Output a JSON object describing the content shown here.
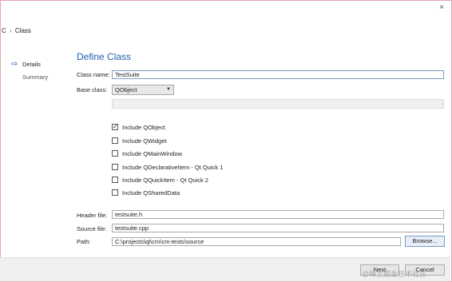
{
  "dialog": {
    "close_glyph": "×"
  },
  "breadcrumb": {
    "parent": "C",
    "separator": "›",
    "current": "Class"
  },
  "sidebar": {
    "items": [
      {
        "label": "Details",
        "active": true
      },
      {
        "label": "Summary",
        "active": false
      }
    ]
  },
  "page": {
    "title": "Define Class"
  },
  "form": {
    "class_name_label": "Class name:",
    "class_name_value": "TestSuite",
    "base_class_label": "Base class:",
    "base_class_value": "QObject",
    "checkboxes": [
      {
        "label": "Include QObject",
        "checked": true
      },
      {
        "label": "Include QWidget",
        "checked": false
      },
      {
        "label": "Include QMainWindow",
        "checked": false
      },
      {
        "label": "Include QDeclarativeItem - Qt Quick 1",
        "checked": false
      },
      {
        "label": "Include QQuickItem - Qt Quick 2",
        "checked": false
      },
      {
        "label": "Include QSharedData",
        "checked": false
      }
    ],
    "header_file_label": "Header file:",
    "header_file_value": "testsuite.h",
    "source_file_label": "Source file:",
    "source_file_value": "testsuite.cpp",
    "path_label": "Path:",
    "path_value": "C:\\projects\\qt\\cm\\cm-tests\\source",
    "browse_label": "Browse..."
  },
  "footer": {
    "next_label": "Next",
    "cancel_label": "Cancel"
  },
  "watermark": {
    "text": "@稀土掘金技术社区"
  },
  "colors": {
    "accent": "#1f5fb2",
    "frame_border": "#e3a7b5",
    "footer_bg": "#f0f0f0"
  }
}
